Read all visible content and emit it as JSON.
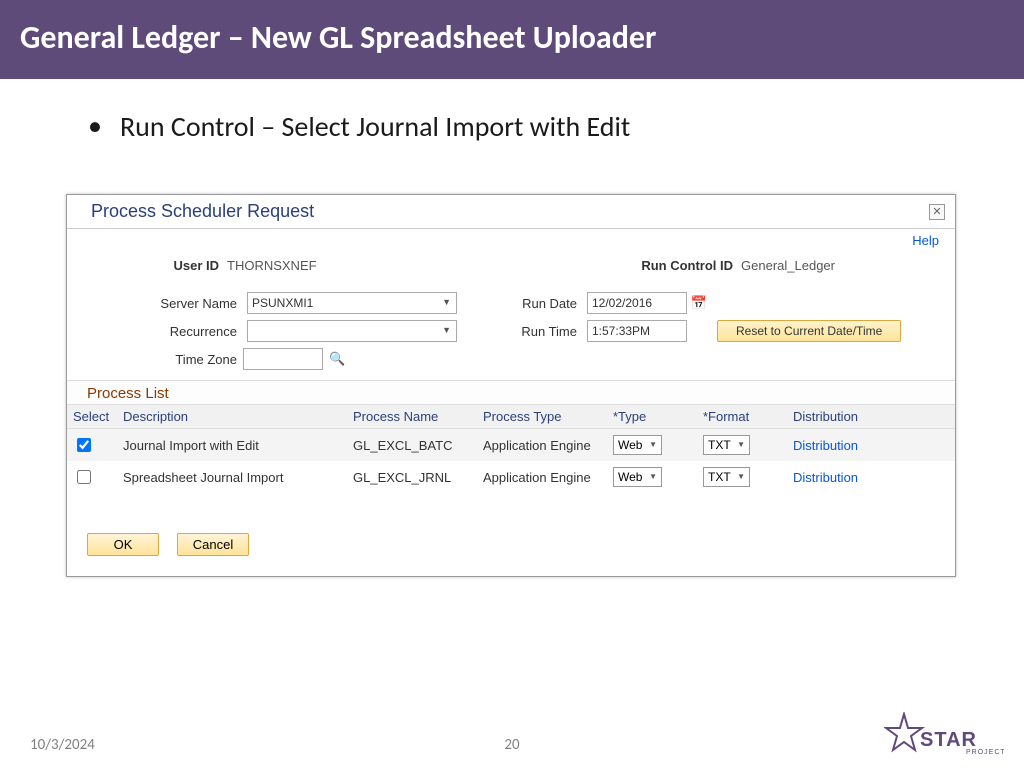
{
  "slide": {
    "title": "General Ledger – New GL Spreadsheet Uploader",
    "bullet": "Run Control – Select Journal Import with Edit",
    "date": "10/3/2024",
    "page": "20"
  },
  "dialog": {
    "title": "Process Scheduler Request",
    "help": "Help",
    "user_id_label": "User ID",
    "user_id": "THORNSXNEF",
    "run_control_label": "Run Control ID",
    "run_control": "General_Ledger",
    "server_label": "Server Name",
    "server_value": "PSUNXMI1",
    "recurrence_label": "Recurrence",
    "recurrence_value": "",
    "timezone_label": "Time Zone",
    "timezone_value": "",
    "run_date_label": "Run Date",
    "run_date": "12/02/2016",
    "run_time_label": "Run Time",
    "run_time": "1:57:33PM",
    "reset_btn": "Reset to Current Date/Time",
    "process_list_title": "Process List",
    "columns": {
      "select": "Select",
      "description": "Description",
      "process_name": "Process Name",
      "process_type": "Process Type",
      "type": "*Type",
      "format": "*Format",
      "distribution": "Distribution"
    },
    "rows": [
      {
        "checked": true,
        "description": "Journal Import with Edit",
        "process_name": "GL_EXCL_BATC",
        "process_type": "Application Engine",
        "type": "Web",
        "format": "TXT",
        "distribution": "Distribution"
      },
      {
        "checked": false,
        "description": "Spreadsheet Journal Import",
        "process_name": "GL_EXCL_JRNL",
        "process_type": "Application Engine",
        "type": "Web",
        "format": "TXT",
        "distribution": "Distribution"
      }
    ],
    "ok": "OK",
    "cancel": "Cancel"
  }
}
